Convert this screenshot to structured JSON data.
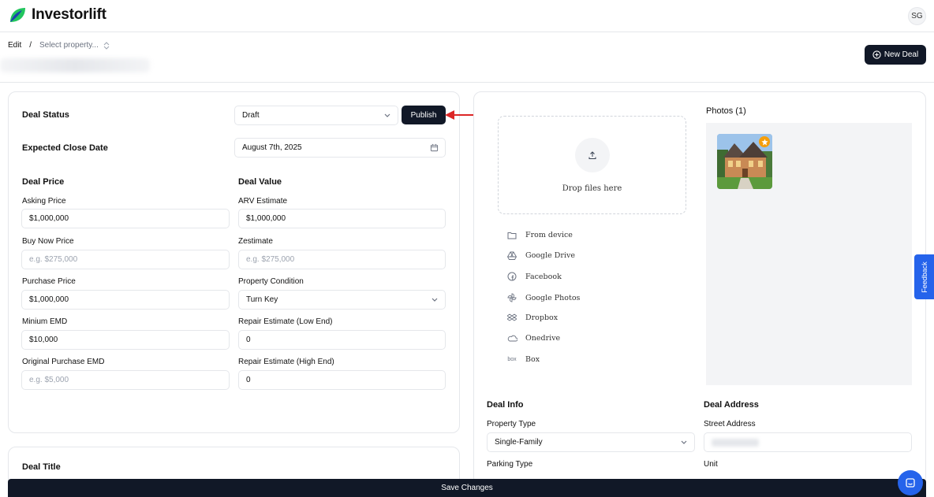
{
  "app": {
    "name": "Investorlift",
    "avatar_initials": "SG"
  },
  "breadcrumb": {
    "edit": "Edit",
    "sep": "/",
    "select": "Select property..."
  },
  "header": {
    "new_deal": "New Deal"
  },
  "deal": {
    "status_label": "Deal Status",
    "status_value": "Draft",
    "publish": "Publish",
    "close_date_label": "Expected Close Date",
    "close_date_value": "August 7th, 2025",
    "price_heading": "Deal Price",
    "value_heading": "Deal Value",
    "asking_price_label": "Asking Price",
    "asking_price_value": "$1,000,000",
    "buy_now_label": "Buy Now Price",
    "buy_now_placeholder": "e.g. $275,000",
    "purchase_price_label": "Purchase Price",
    "purchase_price_value": "$1,000,000",
    "min_emd_label": "Minium EMD",
    "min_emd_value": "$10,000",
    "orig_emd_label": "Original Purchase EMD",
    "orig_emd_placeholder": "e.g. $5,000",
    "arv_label": "ARV Estimate",
    "arv_value": "$1,000,000",
    "zestimate_label": "Zestimate",
    "zestimate_placeholder": "e.g. $275,000",
    "condition_label": "Property Condition",
    "condition_value": "Turn Key",
    "repair_low_label": "Repair Estimate (Low End)",
    "repair_low_value": "0",
    "repair_high_label": "Repair Estimate (High End)",
    "repair_high_value": "0",
    "title_heading": "Deal Title"
  },
  "upload": {
    "drop_text": "Drop files here",
    "sources": [
      "From device",
      "Google Drive",
      "Facebook",
      "Google Photos",
      "Dropbox",
      "Onedrive",
      "Box"
    ],
    "photos_title": "Photos (1)"
  },
  "info": {
    "heading": "Deal Info",
    "property_type_label": "Property Type",
    "property_type_value": "Single-Family",
    "parking_label": "Parking Type"
  },
  "address": {
    "heading": "Deal Address",
    "street_label": "Street Address",
    "unit_label": "Unit"
  },
  "feedback": "Feedback",
  "save": "Save Changes"
}
